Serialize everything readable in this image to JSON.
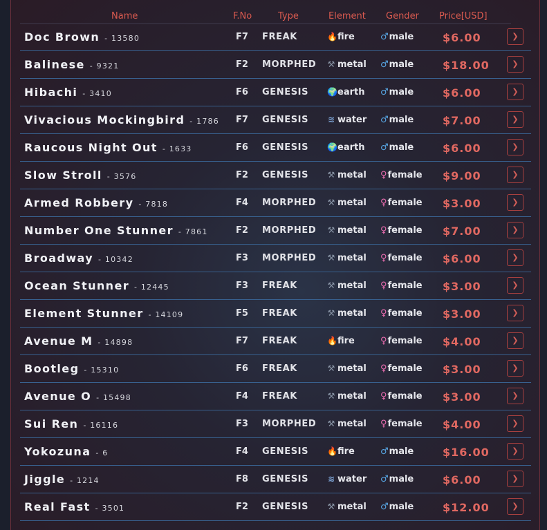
{
  "headers": {
    "name": "Name",
    "fno": "F.No",
    "type": "Type",
    "element": "Element",
    "gender": "Gender",
    "price": "Price[USD]"
  },
  "rows": [
    {
      "name": "Doc Brown",
      "num": "- 13580",
      "fno": "F7",
      "type": "FREAK",
      "element": "fire",
      "gender": "male",
      "price": "$6.00"
    },
    {
      "name": "Balinese",
      "num": "- 9321",
      "fno": "F2",
      "type": "MORPHED",
      "element": "metal",
      "gender": "male",
      "price": "$18.00"
    },
    {
      "name": "Hibachi",
      "num": "- 3410",
      "fno": "F6",
      "type": "GENESIS",
      "element": "earth",
      "gender": "male",
      "price": "$6.00"
    },
    {
      "name": "Vivacious Mockingbird",
      "num": "- 1786",
      "fno": "F7",
      "type": "GENESIS",
      "element": "water",
      "gender": "male",
      "price": "$7.00"
    },
    {
      "name": "Raucous Night Out",
      "num": "- 1633",
      "fno": "F6",
      "type": "GENESIS",
      "element": "earth",
      "gender": "male",
      "price": "$6.00"
    },
    {
      "name": "Slow Stroll",
      "num": "- 3576",
      "fno": "F2",
      "type": "GENESIS",
      "element": "metal",
      "gender": "female",
      "price": "$9.00"
    },
    {
      "name": "Armed Robbery",
      "num": "- 7818",
      "fno": "F4",
      "type": "MORPHED",
      "element": "metal",
      "gender": "female",
      "price": "$3.00"
    },
    {
      "name": "Number One Stunner",
      "num": "- 7861",
      "fno": "F2",
      "type": "MORPHED",
      "element": "metal",
      "gender": "female",
      "price": "$7.00"
    },
    {
      "name": "Broadway",
      "num": "- 10342",
      "fno": "F3",
      "type": "MORPHED",
      "element": "metal",
      "gender": "female",
      "price": "$6.00"
    },
    {
      "name": "Ocean Stunner",
      "num": "- 12445",
      "fno": "F3",
      "type": "FREAK",
      "element": "metal",
      "gender": "female",
      "price": "$3.00"
    },
    {
      "name": "Element Stunner",
      "num": "- 14109",
      "fno": "F5",
      "type": "FREAK",
      "element": "metal",
      "gender": "female",
      "price": "$3.00"
    },
    {
      "name": "Avenue M",
      "num": "- 14898",
      "fno": "F7",
      "type": "FREAK",
      "element": "fire",
      "gender": "female",
      "price": "$4.00"
    },
    {
      "name": "Bootleg",
      "num": "- 15310",
      "fno": "F6",
      "type": "FREAK",
      "element": "metal",
      "gender": "female",
      "price": "$3.00"
    },
    {
      "name": "Avenue O",
      "num": "- 15498",
      "fno": "F4",
      "type": "FREAK",
      "element": "metal",
      "gender": "female",
      "price": "$3.00"
    },
    {
      "name": "Sui Ren",
      "num": "- 16116",
      "fno": "F3",
      "type": "MORPHED",
      "element": "metal",
      "gender": "female",
      "price": "$4.00"
    },
    {
      "name": "Yokozuna",
      "num": "- 6",
      "fno": "F4",
      "type": "GENESIS",
      "element": "fire",
      "gender": "male",
      "price": "$16.00"
    },
    {
      "name": "Jiggle",
      "num": "- 1214",
      "fno": "F8",
      "type": "GENESIS",
      "element": "water",
      "gender": "male",
      "price": "$6.00"
    },
    {
      "name": "Real Fast",
      "num": "- 3501",
      "fno": "F2",
      "type": "GENESIS",
      "element": "metal",
      "gender": "male",
      "price": "$12.00"
    }
  ],
  "icons": {
    "element": {
      "fire": "fire-icon",
      "metal": "hammer-icon",
      "earth": "globe-icon",
      "water": "waves-icon"
    },
    "gender": {
      "male": "male-symbol-icon",
      "female": "female-symbol-icon"
    },
    "action": "chevron-right-icon"
  },
  "colors": {
    "accent": "#d95a4f",
    "price": "#e06861",
    "row_divider": "#38618f",
    "male": "#58a8e6",
    "female": "#ee6fb3",
    "fire": "#f08a2a"
  }
}
